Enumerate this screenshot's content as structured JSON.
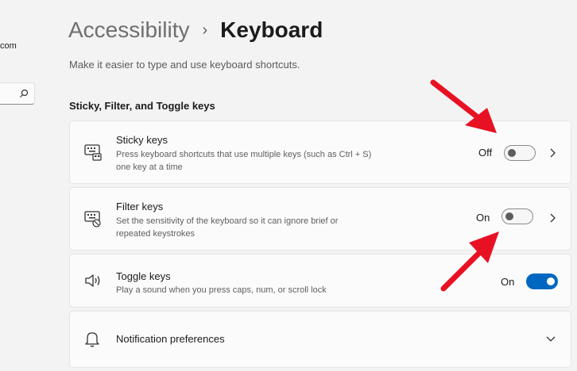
{
  "sidebar": {
    "partial_text": "com",
    "search_icon": "search-icon"
  },
  "header": {
    "parent": "Accessibility",
    "separator": "›",
    "current": "Keyboard"
  },
  "page": {
    "description": "Make it easier to type and use keyboard shortcuts."
  },
  "section": {
    "title": "Sticky, Filter, and Toggle keys"
  },
  "settings": [
    {
      "title": "Sticky keys",
      "desc_line1": "Press keyboard shortcuts that use multiple keys (such as Ctrl + S)",
      "desc_line2": "one key at a time",
      "state": "Off",
      "toggle_on": false,
      "icon": "sticky-keys-icon"
    },
    {
      "title": "Filter keys",
      "desc_line1": "Set the sensitivity of the keyboard so it can ignore brief or",
      "desc_line2": "repeated keystrokes",
      "state": "On",
      "toggle_on": false,
      "icon": "filter-keys-icon"
    },
    {
      "title": "Toggle keys",
      "desc_line1": "Play a sound when you press caps, num, or scroll lock",
      "state": "On",
      "toggle_on": true,
      "icon": "speaker-icon"
    },
    {
      "title": "Notification preferences",
      "icon": "bell-icon"
    }
  ],
  "colors": {
    "accent": "#0067c0",
    "annotation_arrow": "#e81123"
  }
}
